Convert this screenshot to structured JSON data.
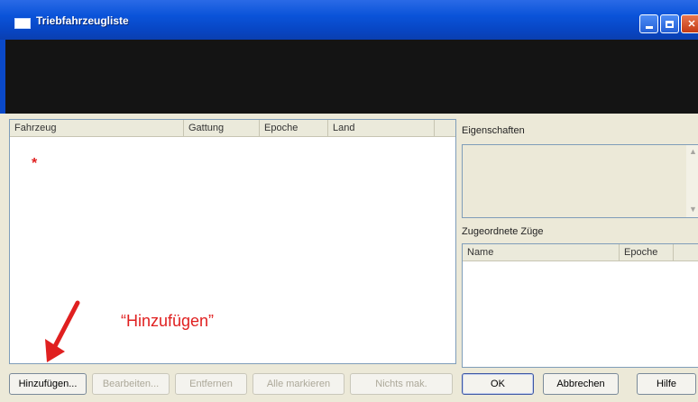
{
  "window": {
    "title": "Triebfahrzeugliste"
  },
  "vehicle_list": {
    "columns": [
      "Fahrzeug",
      "Gattung",
      "Epoche",
      "Land"
    ],
    "marker": "*"
  },
  "properties": {
    "label": "Eigenschaften"
  },
  "trains": {
    "label": "Zugeordnete Züge",
    "columns": [
      "Name",
      "Epoche"
    ]
  },
  "buttons": {
    "add": "Hinzufügen...",
    "edit": "Bearbeiten...",
    "remove": "Entfernen",
    "select_all": "Alle markieren",
    "deselect": "Nichts mak.",
    "ok": "OK",
    "cancel": "Abbrechen",
    "help": "Hilfe"
  },
  "annotation": {
    "text": "“Hinzufügen”"
  },
  "colors": {
    "titlebar": "#0a53d9",
    "annotation": "#e02020",
    "preview": "#141414"
  }
}
